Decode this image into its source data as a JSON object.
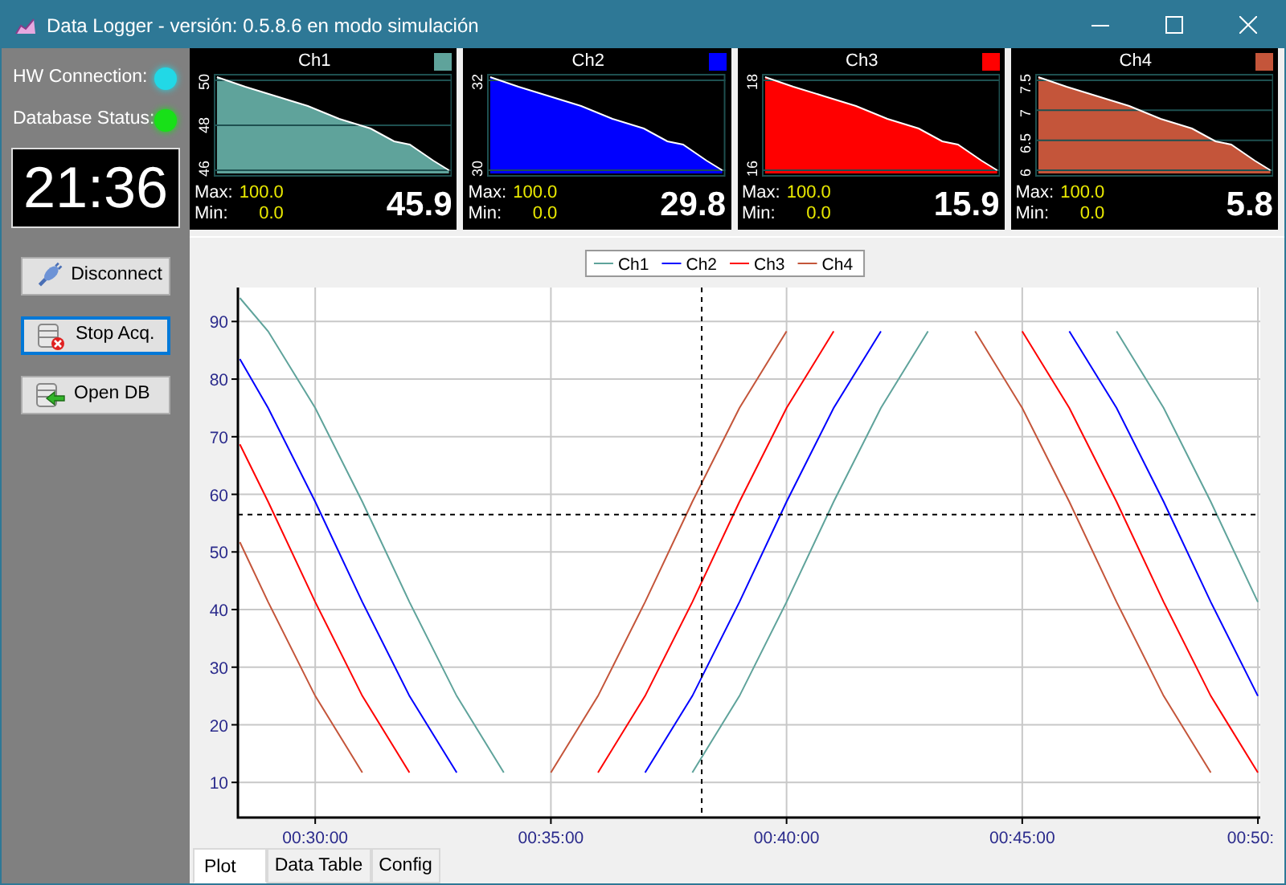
{
  "window": {
    "title": "Data Logger - versión: 0.5.8.6 en modo simulación"
  },
  "status": [
    {
      "label": "HW Connection:",
      "color": "#22d8e6"
    },
    {
      "label": "Database Status:",
      "color": "#18e018"
    }
  ],
  "clock": "21:36",
  "buttons": [
    {
      "label": "Disconnect",
      "kind": "plug",
      "focused": false
    },
    {
      "label": "Stop Acq.",
      "kind": "db-stop",
      "focused": true
    },
    {
      "label": "Open DB",
      "kind": "db-open",
      "focused": false
    }
  ],
  "channels": [
    {
      "name": "Ch1",
      "color": "#5fa39b",
      "axis_labels": [
        "50",
        "48",
        "46"
      ],
      "max_label": "Max:",
      "max": "100.0",
      "min_label": "Min:",
      "min": "0.0",
      "value": "45.9"
    },
    {
      "name": "Ch2",
      "color": "#0000ff",
      "axis_labels": [
        "32",
        "30"
      ],
      "max_label": "Max:",
      "max": "100.0",
      "min_label": "Min:",
      "min": "0.0",
      "value": "29.8"
    },
    {
      "name": "Ch3",
      "color": "#ff0000",
      "axis_labels": [
        "18",
        "16"
      ],
      "max_label": "Max:",
      "max": "100.0",
      "min_label": "Min:",
      "min": "0.0",
      "value": "15.9"
    },
    {
      "name": "Ch4",
      "color": "#c4553a",
      "axis_labels": [
        "7.5",
        "7",
        "6.5",
        "6"
      ],
      "max_label": "Max:",
      "max": "100.0",
      "min_label": "Min:",
      "min": "0.0",
      "value": "5.8"
    }
  ],
  "plot": {
    "chart_data": {
      "type": "line",
      "x": [
        28.4,
        29,
        30,
        31,
        32,
        33,
        34,
        35,
        36,
        37,
        38,
        39,
        40,
        41,
        42,
        43,
        44,
        45,
        46,
        47,
        48,
        49,
        50
      ],
      "series": [
        {
          "name": "Ch1",
          "color": "#5fa39b",
          "values": [
            94.1,
            88.3,
            75.0,
            58.7,
            41.3,
            25.0,
            11.7,
            null,
            null,
            null,
            11.7,
            25.0,
            41.3,
            58.7,
            75.0,
            88.3,
            null,
            null,
            null,
            88.3,
            75.0,
            58.7,
            41.3
          ]
        },
        {
          "name": "Ch2",
          "color": "#0000ff",
          "values": [
            83.5,
            75.0,
            58.7,
            41.3,
            25.0,
            11.7,
            null,
            null,
            null,
            11.7,
            25.0,
            41.3,
            58.7,
            75.0,
            88.3,
            null,
            null,
            null,
            88.3,
            75.0,
            58.7,
            41.3,
            25.0
          ]
        },
        {
          "name": "Ch3",
          "color": "#ff0000",
          "values": [
            68.7,
            58.7,
            41.3,
            25.0,
            11.7,
            null,
            null,
            null,
            11.7,
            25.0,
            41.3,
            58.7,
            75.0,
            88.3,
            null,
            null,
            null,
            88.3,
            75.0,
            58.7,
            41.3,
            25.0,
            11.7
          ]
        },
        {
          "name": "Ch4",
          "color": "#c4553a",
          "values": [
            51.7,
            41.3,
            25.0,
            11.7,
            null,
            null,
            null,
            11.7,
            25.0,
            41.3,
            58.7,
            75.0,
            88.3,
            null,
            null,
            null,
            88.3,
            75.0,
            58.7,
            41.3,
            25.0,
            11.7,
            null
          ]
        }
      ],
      "xlim": [
        28.36,
        50.05
      ],
      "ylim": [
        3.9,
        95.9
      ],
      "xticks": [
        {
          "value": 30,
          "label": "00:30:00"
        },
        {
          "value": 35,
          "label": "00:35:00"
        },
        {
          "value": 40,
          "label": "00:40:00"
        },
        {
          "value": 45,
          "label": "00:45:00"
        },
        {
          "value": 50,
          "label": "00:50:"
        }
      ],
      "yticks": [
        10,
        20,
        30,
        40,
        50,
        60,
        70,
        80,
        90
      ],
      "grid": true,
      "legend": true,
      "ref_lines": [
        {
          "axis": "x",
          "value": 38.2
        },
        {
          "axis": "y",
          "value": 56.5
        }
      ]
    }
  },
  "tabs": [
    {
      "label": "Plot",
      "selected": true
    },
    {
      "label": "Data Table",
      "selected": false
    },
    {
      "label": "Config",
      "selected": false
    }
  ]
}
